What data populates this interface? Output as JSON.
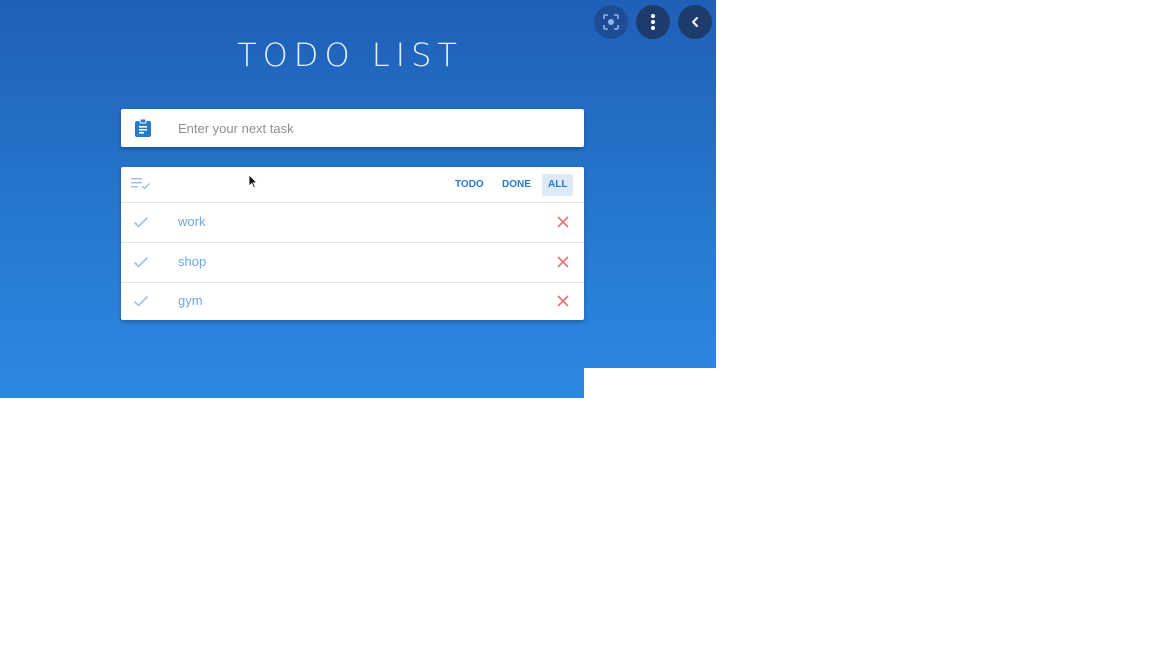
{
  "app": {
    "title": "TODO LIST"
  },
  "task_input": {
    "placeholder": "Enter your next task",
    "value": ""
  },
  "filters": {
    "todo_label": "TODO",
    "done_label": "DONE",
    "all_label": "ALL",
    "active": "ALL"
  },
  "tasks": [
    {
      "label": "work",
      "done": true
    },
    {
      "label": "shop",
      "done": true
    },
    {
      "label": "gym",
      "done": true
    }
  ],
  "icons": {
    "clipboard": "clipboard-icon",
    "filter": "playlist-check-icon",
    "check": "check-icon",
    "delete": "close-icon",
    "lens": "google-lens-icon",
    "menu": "more-vertical-icon",
    "back": "chevron-left-icon"
  },
  "colors": {
    "background_top": "#1f5fb8",
    "background_bottom": "#2c86de",
    "accent": "#2a7acb",
    "task_text": "#6ea6de",
    "delete": "#e57373",
    "active_filter_bg": "#dde9f6"
  }
}
